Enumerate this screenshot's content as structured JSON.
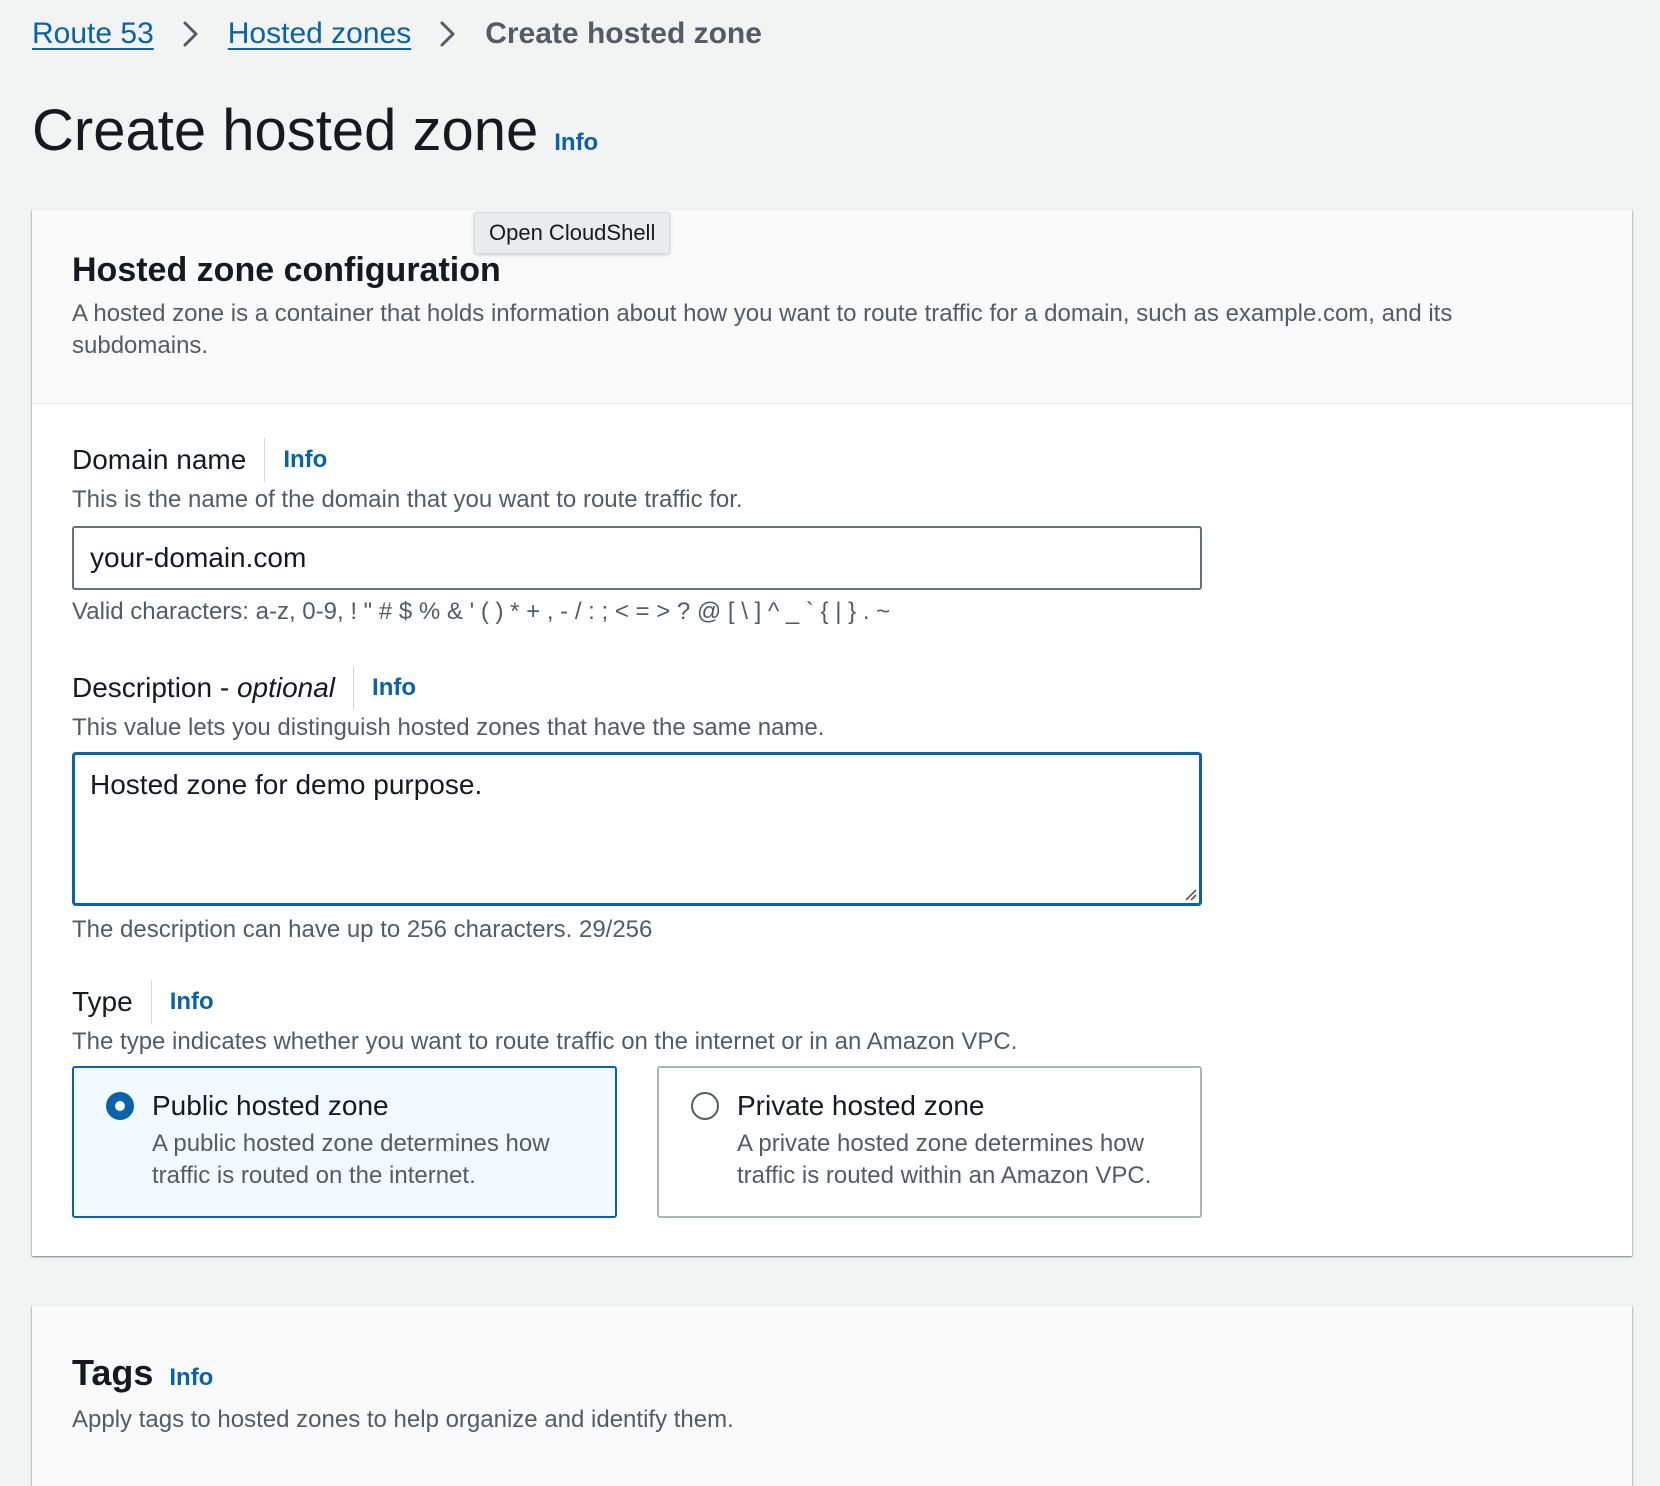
{
  "breadcrumb": {
    "items": [
      "Route 53",
      "Hosted zones"
    ],
    "current": "Create hosted zone"
  },
  "page": {
    "title": "Create hosted zone",
    "info_label": "Info"
  },
  "tooltip": {
    "text": "Open CloudShell"
  },
  "config": {
    "title": "Hosted zone configuration",
    "description": "A hosted zone is a container that holds information about how you want to route traffic for a domain, such as example.com, and its subdomains.",
    "domain": {
      "label": "Domain name",
      "info": "Info",
      "description": "This is the name of the domain that you want to route traffic for.",
      "value": "your-domain.com",
      "hint": "Valid characters: a-z, 0-9, ! \" # $ % & ' ( ) * + , - / : ; < = > ? @ [ \\ ] ^ _ ` { | } . ~"
    },
    "desc_field": {
      "label_main": "Description - ",
      "label_optional": "optional",
      "info": "Info",
      "description": "This value lets you distinguish hosted zones that have the same name.",
      "value": "Hosted zone for demo purpose.",
      "hint": "The description can have up to 256 characters. 29/256"
    },
    "type": {
      "label": "Type",
      "info": "Info",
      "description": "The type indicates whether you want to route traffic on the internet or in an Amazon VPC.",
      "options": [
        {
          "title": "Public hosted zone",
          "description": "A public hosted zone determines how traffic is routed on the internet.",
          "selected": true
        },
        {
          "title": "Private hosted zone",
          "description": "A private hosted zone determines how traffic is routed within an Amazon VPC.",
          "selected": false
        }
      ]
    }
  },
  "tags": {
    "title": "Tags",
    "info": "Info",
    "description": "Apply tags to hosted zones to help organize and identify them."
  },
  "colors": {
    "link": "#0a62a8",
    "page_bg": "#f2f3f3",
    "selected_tile_bg": "#f1faff",
    "secondary_text": "#545b64"
  }
}
